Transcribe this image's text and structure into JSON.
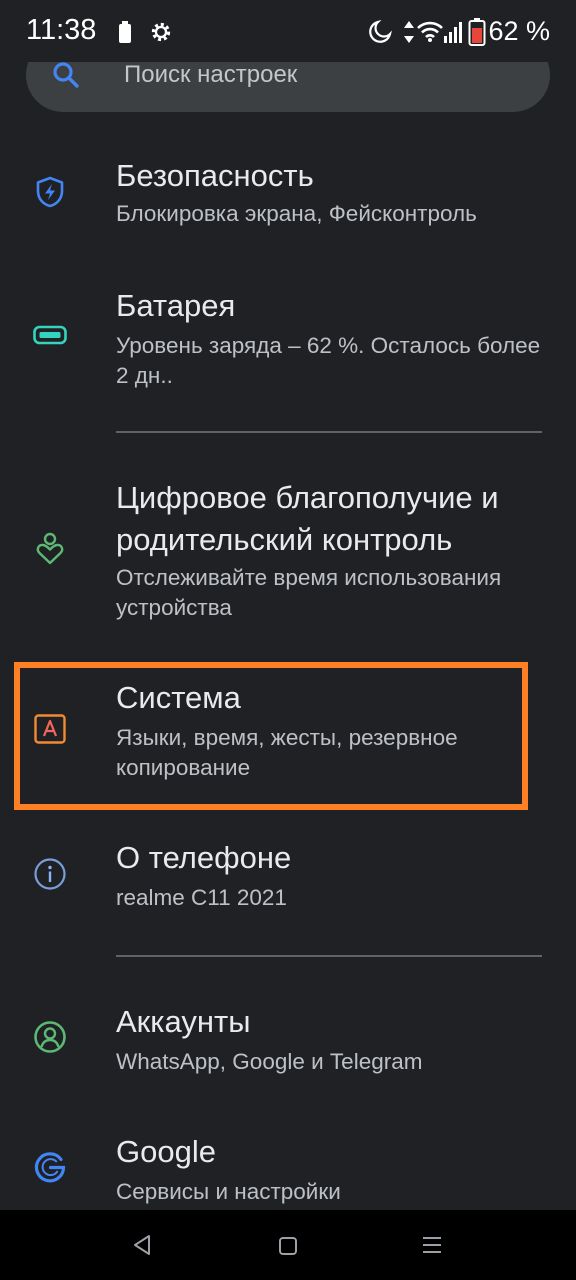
{
  "status_bar": {
    "time": "11:38",
    "battery_percent": "62 %"
  },
  "search": {
    "placeholder": "Поиск настроек"
  },
  "items": [
    {
      "title": "Безопасность",
      "subtitle": "Блокировка экрана, Фейсконтроль",
      "icon": "shield-icon",
      "color": "#4285f4"
    },
    {
      "title": "Батарея",
      "subtitle": "Уровень заряда – 62 %. Осталось более 2 дн..",
      "icon": "battery-icon",
      "color": "#34d3c0"
    },
    {
      "title_line1": "Цифровое благополучие и",
      "title_line2": "родительский контроль",
      "subtitle": "Отслеживайте время использования устройства",
      "icon": "wellbeing-icon",
      "color": "#5bb974"
    },
    {
      "title": "Система",
      "subtitle": "Языки, время, жесты, резервное копирование",
      "icon": "system-icon",
      "color": "#f28b30"
    },
    {
      "title": "О телефоне",
      "subtitle": "realme C11 2021",
      "icon": "info-icon",
      "color": "#9aa0a6"
    },
    {
      "title": "Аккаунты",
      "subtitle": "WhatsApp, Google и Telegram",
      "icon": "accounts-icon",
      "color": "#5bb974"
    },
    {
      "title": "Google",
      "subtitle": "Сервисы и настройки",
      "icon": "google-icon",
      "color": "#4285f4"
    }
  ],
  "colors": {
    "background": "#202124",
    "highlight": "#ff7f24",
    "accent": "#4285f4"
  }
}
